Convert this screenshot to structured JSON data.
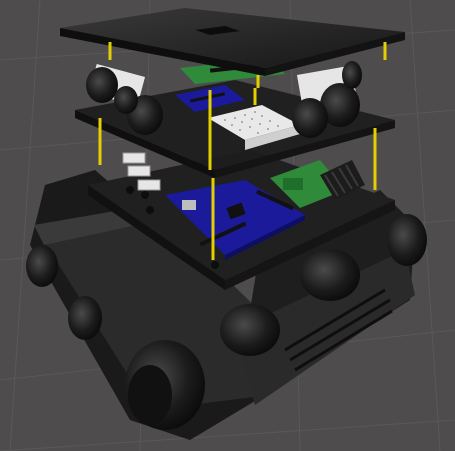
{
  "scene": {
    "subject": "robot-tank-chassis-render",
    "colors": {
      "background": "#4e4c4c",
      "grid": "#5a5858",
      "plate": "#222222",
      "plate_edge": "#3a3a3a",
      "standoff": "#e4d000",
      "board_blue": "#1a1a9a",
      "board_green": "#2f8a3a",
      "breadboard": "#e8e8e8",
      "sensor_white": "#e6e6e6",
      "heatsink": "#1c1c1c"
    }
  }
}
